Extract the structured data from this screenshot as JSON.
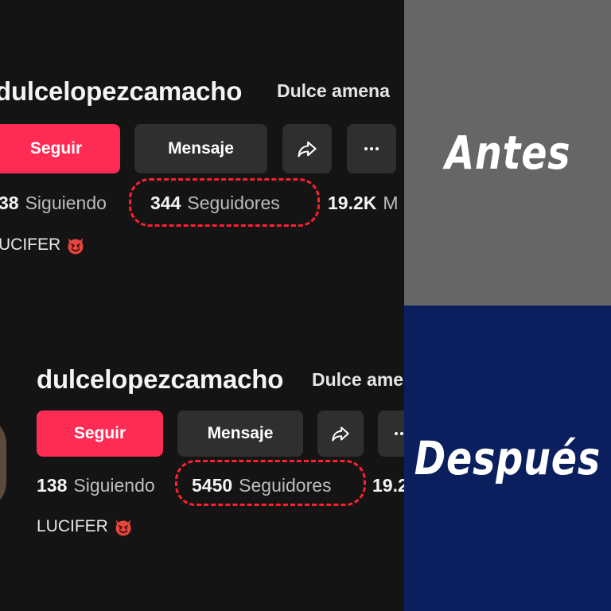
{
  "before": {
    "username": "dulcelopezcamacho",
    "display_name": "Dulce amena",
    "follow_label": "Seguir",
    "message_label": "Mensaje",
    "following_count": "38",
    "following_label": "Siguiendo",
    "followers_count": "344",
    "followers_label": "Seguidores",
    "likes_count": "19.2K",
    "likes_label": "M",
    "bio": "UCIFER"
  },
  "after": {
    "username": "dulcelopezcamacho",
    "display_name": "Dulce ame",
    "follow_label": "Seguir",
    "message_label": "Mensaje",
    "following_count": "138",
    "following_label": "Siguiendo",
    "followers_count": "5450",
    "followers_label": "Seguidores",
    "likes_count": "19.2",
    "bio": "LUCIFER"
  },
  "labels": {
    "before": "Antes",
    "after": "Después"
  },
  "icons": [
    "share-icon",
    "more-icon",
    "smiling-devil-emoji-icon"
  ],
  "colors": {
    "follow_button": "#fe2c55",
    "highlight_dash": "#ff1f2f",
    "before_panel": "#666666",
    "after_panel": "#0b1f5e"
  }
}
